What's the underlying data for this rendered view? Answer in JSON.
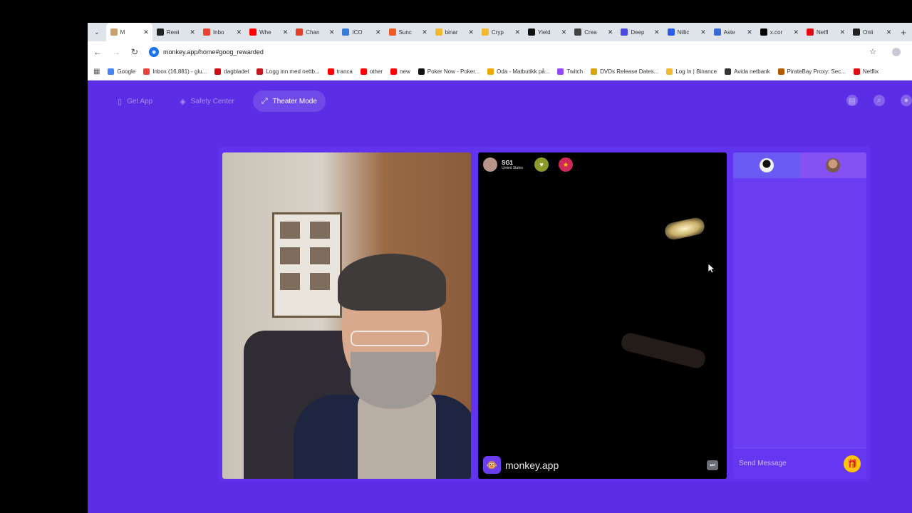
{
  "tabs": [
    {
      "label": "M",
      "color": "#c8a26a",
      "active": true
    },
    {
      "label": "Rewi",
      "color": "#222222"
    },
    {
      "label": "Inbo",
      "color": "#ea4335"
    },
    {
      "label": "Whe",
      "color": "#ff0000"
    },
    {
      "label": "Chan",
      "color": "#e0402a"
    },
    {
      "label": "ICO",
      "color": "#3a7bd5"
    },
    {
      "label": "Sunc",
      "color": "#f05a28"
    },
    {
      "label": "binar",
      "color": "#f3ba2f"
    },
    {
      "label": "Cryp",
      "color": "#f3ba2f"
    },
    {
      "label": "Yield",
      "color": "#111111"
    },
    {
      "label": "Crea",
      "color": "#444444"
    },
    {
      "label": "Deep",
      "color": "#4a4ae0"
    },
    {
      "label": "Nillic",
      "color": "#2b5ce6"
    },
    {
      "label": "Aste",
      "color": "#3a6cd6"
    },
    {
      "label": "x.cor",
      "color": "#000000"
    },
    {
      "label": "Netfl",
      "color": "#e50914"
    },
    {
      "label": "Onli",
      "color": "#222222"
    }
  ],
  "address": "monkey.app/home#goog_rewarded",
  "bookmarks": [
    {
      "label": "Google",
      "color": "#4285f4"
    },
    {
      "label": "Inbox (16,881) - glu...",
      "color": "#ea4335"
    },
    {
      "label": "dagbladet",
      "color": "#d10a11"
    },
    {
      "label": "Logg inn med nettb...",
      "color": "#c4161c"
    },
    {
      "label": "tranca",
      "color": "#ff0000"
    },
    {
      "label": "other",
      "color": "#ff0000"
    },
    {
      "label": "new",
      "color": "#ff0000"
    },
    {
      "label": "Poker Now - Poker...",
      "color": "#111111"
    },
    {
      "label": "Oda - Matbutikk på...",
      "color": "#f0a500"
    },
    {
      "label": "Twitch",
      "color": "#9146ff"
    },
    {
      "label": "DVDs Release Dates...",
      "color": "#d9a400"
    },
    {
      "label": "Log In | Binance",
      "color": "#f3ba2f"
    },
    {
      "label": "Avida netbank",
      "color": "#333333"
    },
    {
      "label": "PirateBay Proxy: Sec...",
      "color": "#b35a00"
    },
    {
      "label": "Netflix",
      "color": "#e50914"
    }
  ],
  "nav": {
    "get_app": "Get App",
    "safety": "Safety Center",
    "theater": "Theater Mode"
  },
  "peer": {
    "name": "SG1",
    "country": "United States"
  },
  "watermark": "monkey.app",
  "chat": {
    "placeholder": "Send Message"
  },
  "colors": {
    "page_bg": "#5b2ee6",
    "accent_gift": "#ffc400"
  }
}
